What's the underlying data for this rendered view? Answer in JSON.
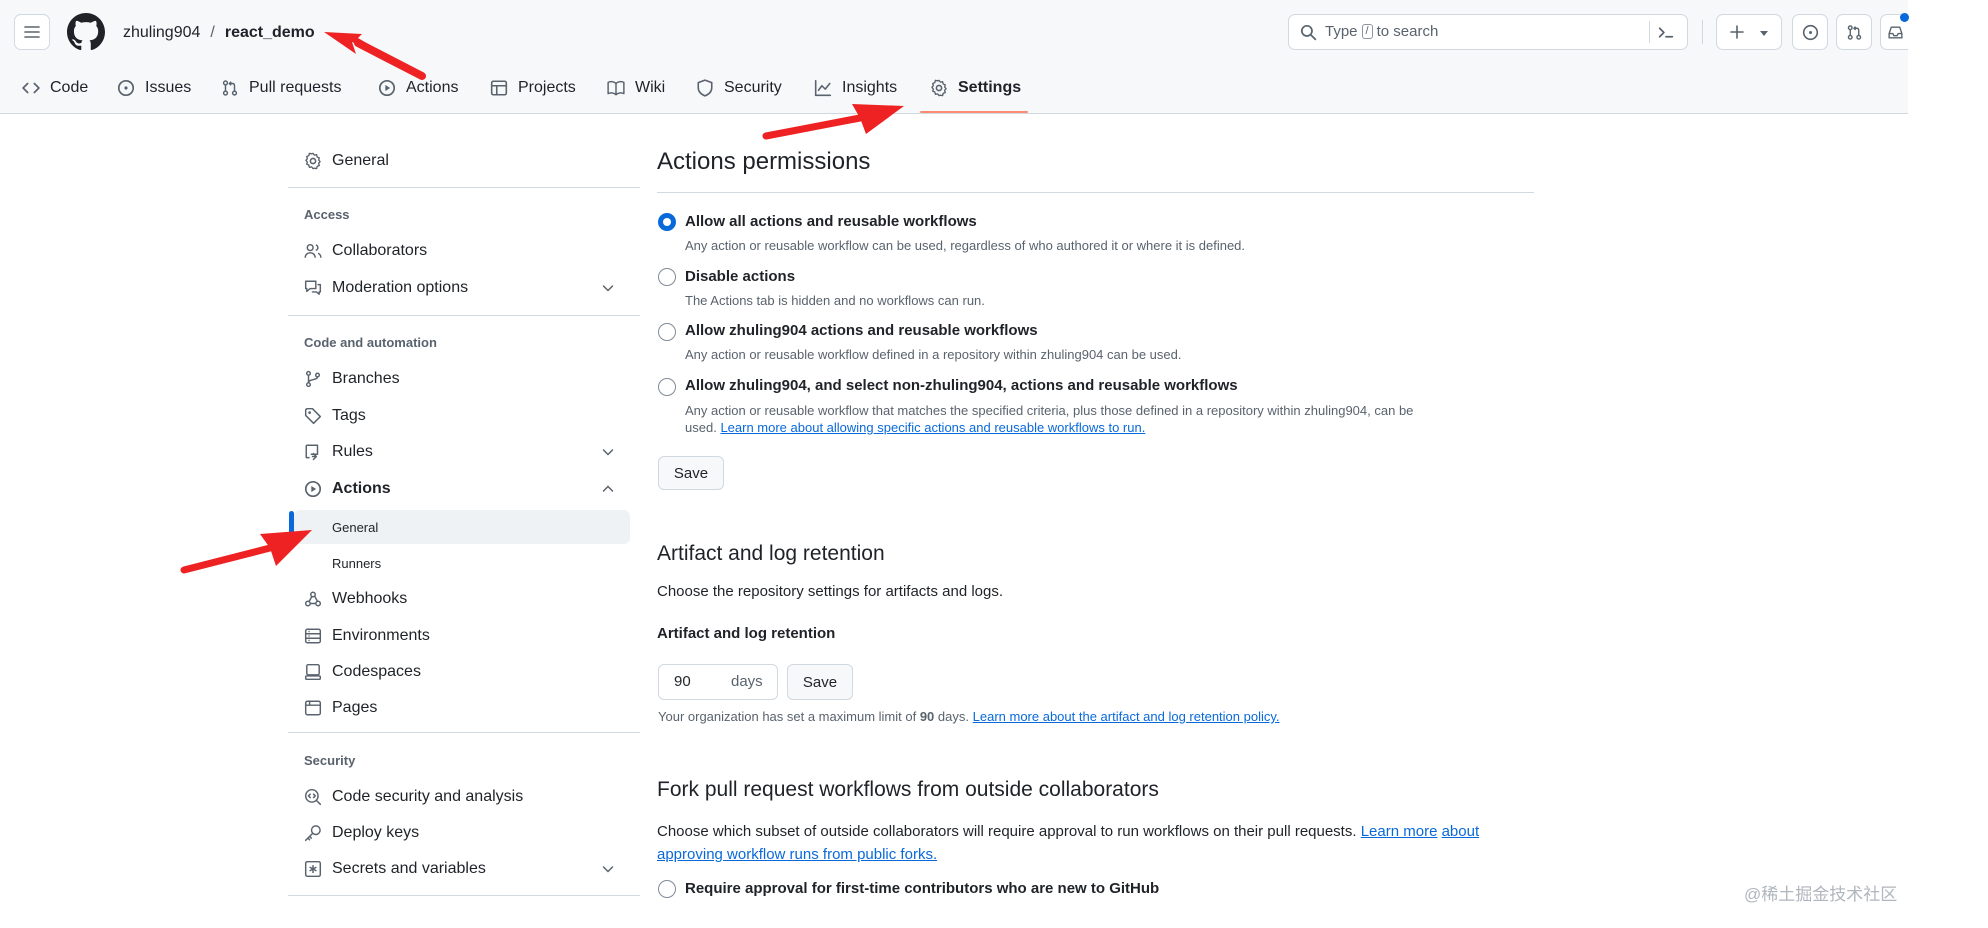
{
  "header": {
    "owner": "zhuling904",
    "separator": "/",
    "repo": "react_demo",
    "search_placeholder_prefix": "Type",
    "search_key": "/",
    "search_placeholder_suffix": "to search"
  },
  "tabs": [
    {
      "label": "Code",
      "icon": "code-icon"
    },
    {
      "label": "Issues",
      "icon": "issue-icon"
    },
    {
      "label": "Pull requests",
      "icon": "pull-request-icon"
    },
    {
      "label": "Actions",
      "icon": "play-icon"
    },
    {
      "label": "Projects",
      "icon": "table-icon"
    },
    {
      "label": "Wiki",
      "icon": "book-icon"
    },
    {
      "label": "Security",
      "icon": "shield-icon"
    },
    {
      "label": "Insights",
      "icon": "graph-icon"
    },
    {
      "label": "Settings",
      "icon": "gear-icon",
      "active": true
    }
  ],
  "sidebar": {
    "general": "General",
    "access_heading": "Access",
    "collaborators": "Collaborators",
    "moderation": "Moderation options",
    "code_heading": "Code and automation",
    "branches": "Branches",
    "tags": "Tags",
    "rules": "Rules",
    "actions": "Actions",
    "actions_general": "General",
    "actions_runners": "Runners",
    "webhooks": "Webhooks",
    "environments": "Environments",
    "codespaces": "Codespaces",
    "pages": "Pages",
    "security_heading": "Security",
    "code_security": "Code security and analysis",
    "deploy_keys": "Deploy keys",
    "secrets": "Secrets and variables"
  },
  "permissions": {
    "title": "Actions permissions",
    "options": [
      {
        "label": "Allow all actions and reusable workflows",
        "desc": "Any action or reusable workflow can be used, regardless of who authored it or where it is defined.",
        "selected": true
      },
      {
        "label": "Disable actions",
        "desc": "The Actions tab is hidden and no workflows can run.",
        "selected": false
      },
      {
        "label": "Allow zhuling904 actions and reusable workflows",
        "desc": "Any action or reusable workflow defined in a repository within zhuling904 can be used.",
        "selected": false
      },
      {
        "label": "Allow zhuling904, and select non-zhuling904, actions and reusable workflows",
        "desc_line1": "Any action or reusable workflow that matches the specified criteria, plus those defined in a repository within zhuling904, can be",
        "desc_line2_prefix": "used.",
        "desc_link": "Learn more about allowing specific actions and reusable workflows to run.",
        "selected": false
      }
    ],
    "save_label": "Save"
  },
  "retention": {
    "title": "Artifact and log retention",
    "desc": "Choose the repository settings for artifacts and logs.",
    "field_label": "Artifact and log retention",
    "value": "90",
    "unit": "days",
    "save_label": "Save",
    "note_prefix": "Your organization has set a maximum limit of",
    "note_value": "90",
    "note_suffix": "days.",
    "note_link": "Learn more about the artifact and log retention policy."
  },
  "fork": {
    "title": "Fork pull request workflows from outside collaborators",
    "desc": "Choose which subset of outside collaborators will require approval to run workflows on their pull requests.",
    "desc_link_1": "Learn more",
    "desc_link_2": "about approving workflow runs from public forks.",
    "option": "Require approval for first-time contributors who are new to GitHub"
  },
  "watermark": "@稀土掘金技术社区",
  "colors": {
    "accent": "#0969da",
    "tab_underline": "#fd8c73",
    "annotation_arrow": "#ee2222",
    "notification_dot": "#0969da"
  }
}
